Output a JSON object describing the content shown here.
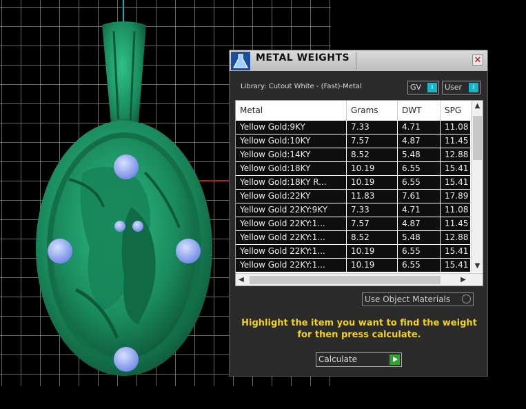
{
  "dialog": {
    "title": "METAL WEIGHTS",
    "close_glyph": "✕",
    "library_label": "Library: Cutout White - (Fast)-Metal",
    "toggles": [
      {
        "label": "GV",
        "knob": "I"
      },
      {
        "label": "User",
        "knob": "I"
      }
    ],
    "table": {
      "columns": [
        "Metal",
        "Grams",
        "DWT",
        "SPG"
      ],
      "rows": [
        [
          "Yellow Gold:9KY",
          "7.33",
          "4.71",
          "11.08"
        ],
        [
          "Yellow Gold:10KY",
          "7.57",
          "4.87",
          "11.45"
        ],
        [
          "Yellow Gold:14KY",
          "8.52",
          "5.48",
          "12.88"
        ],
        [
          "Yellow Gold:18KY",
          "10.19",
          "6.55",
          "15.41"
        ],
        [
          "Yellow Gold:18KY R...",
          "10.19",
          "6.55",
          "15.41"
        ],
        [
          "Yellow Gold:22KY",
          "11.83",
          "7.61",
          "17.89"
        ],
        [
          "Yellow Gold 22KY:9KY",
          "7.33",
          "4.71",
          "11.08"
        ],
        [
          "Yellow Gold 22KY:1...",
          "7.57",
          "4.87",
          "11.45"
        ],
        [
          "Yellow Gold 22KY:1...",
          "8.52",
          "5.48",
          "12.88"
        ],
        [
          "Yellow Gold 22KY:1...",
          "10.19",
          "6.55",
          "15.41"
        ],
        [
          "Yellow Gold 22KY:1...",
          "10.19",
          "6.55",
          "15.41"
        ]
      ]
    },
    "object_materials_label": "Use Object Materials",
    "instructions": "Highlight the item you want to find the weight for then press calculate.",
    "calculate_label": "Calculate"
  },
  "colors": {
    "pendant_green": "#1e9a6a",
    "stone_blue": "#8ea8ff",
    "accent_cyan": "#19b4c8",
    "instruction_yellow": "#f2d21a"
  }
}
